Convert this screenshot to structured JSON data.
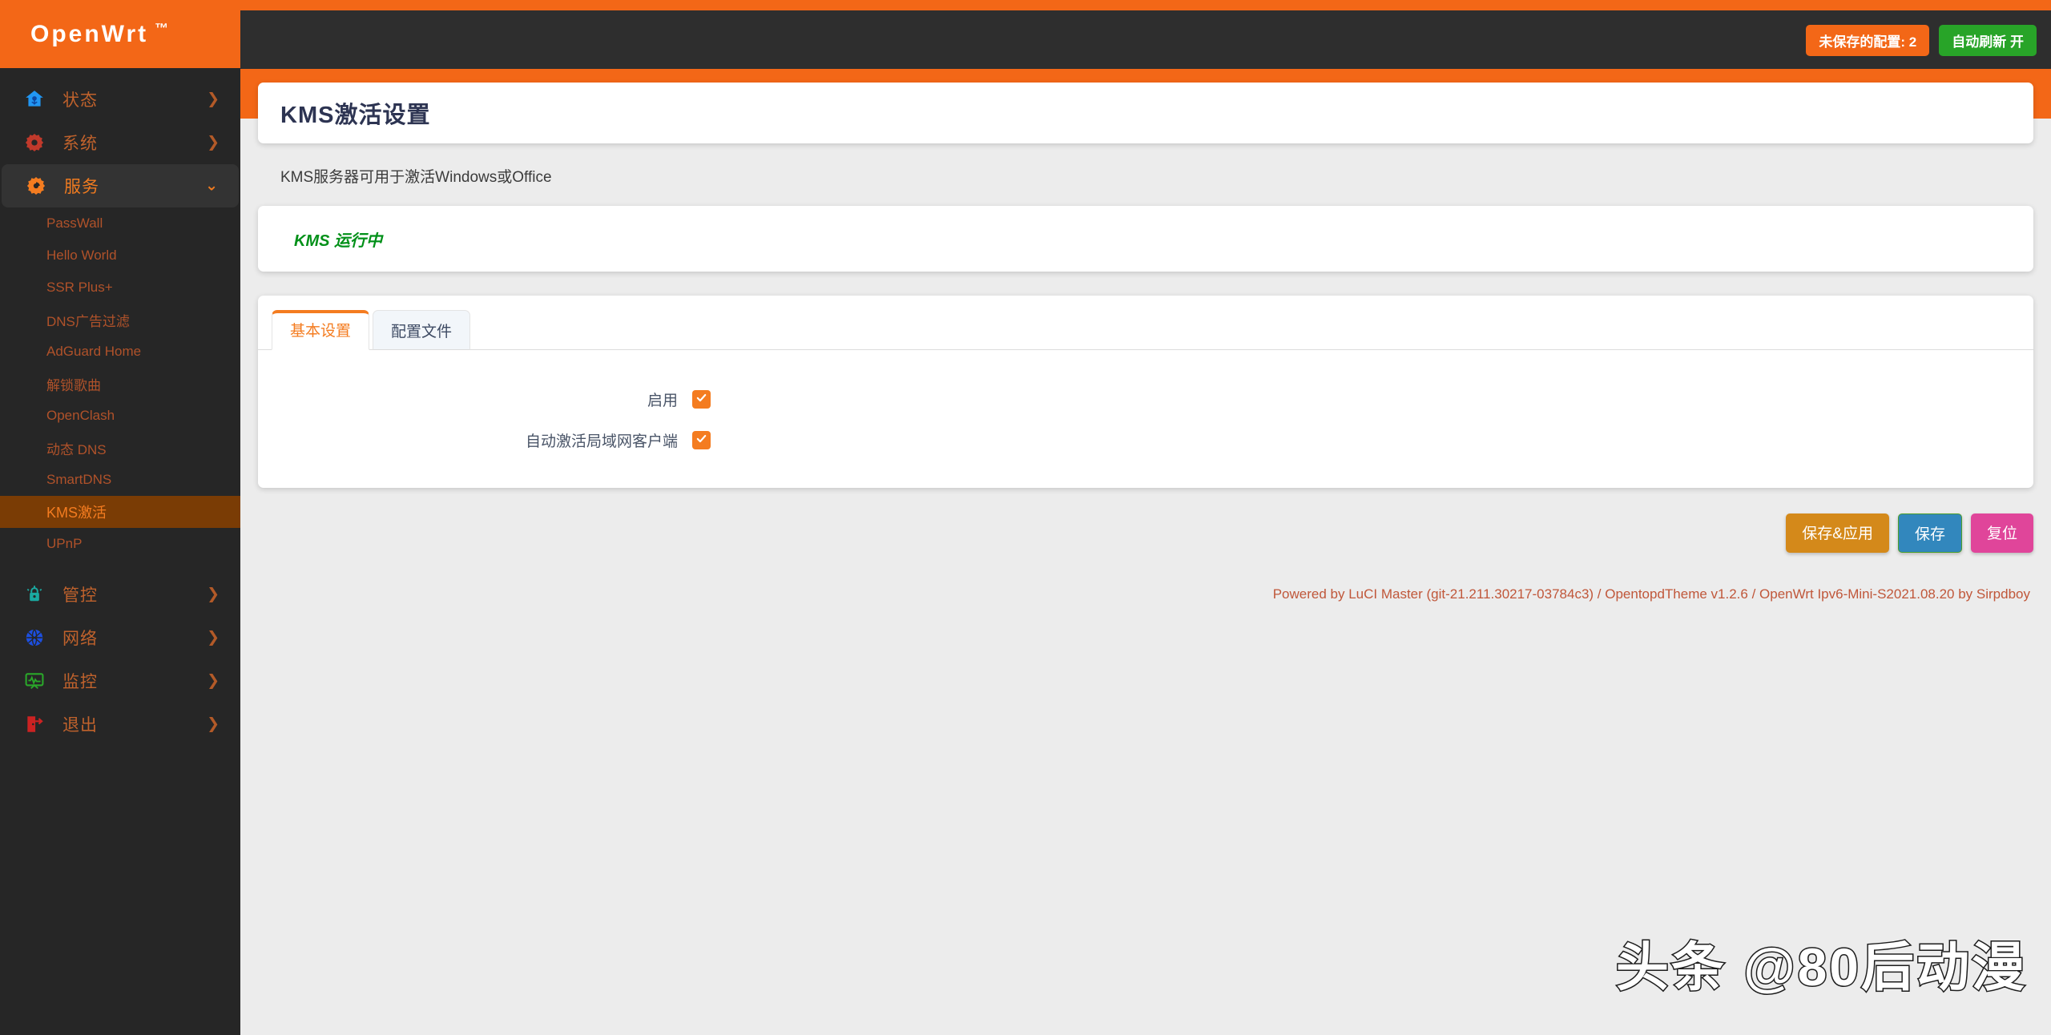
{
  "brand": {
    "name": "OpenWrt",
    "tm": "™"
  },
  "topbar": {
    "unsaved_label": "未保存的配置: 2",
    "autorefresh_label": "自动刷新 开",
    "unsaved_color": "#f36717",
    "autorefresh_color": "#28a428"
  },
  "sidebar": {
    "top_items": [
      {
        "label": "状态",
        "icon": "home-icon",
        "chevron": "❯",
        "expanded": false
      },
      {
        "label": "系统",
        "icon": "gear-icon",
        "chevron": "❯",
        "expanded": false
      },
      {
        "label": "服务",
        "icon": "service-gear-icon",
        "chevron": "⌄",
        "expanded": true
      }
    ],
    "sub_items": [
      {
        "label": "PassWall",
        "active": false
      },
      {
        "label": "Hello World",
        "active": false
      },
      {
        "label": "SSR Plus+",
        "active": false
      },
      {
        "label": "DNS广告过滤",
        "active": false
      },
      {
        "label": "AdGuard Home",
        "active": false
      },
      {
        "label": "解锁歌曲",
        "active": false
      },
      {
        "label": "OpenClash",
        "active": false
      },
      {
        "label": "动态 DNS",
        "active": false
      },
      {
        "label": "SmartDNS",
        "active": false
      },
      {
        "label": "KMS激活",
        "active": true
      },
      {
        "label": "UPnP",
        "active": false
      }
    ],
    "bottom_items": [
      {
        "label": "管控",
        "icon": "lock-alarm-icon",
        "chevron": "❯"
      },
      {
        "label": "网络",
        "icon": "network-icon",
        "chevron": "❯"
      },
      {
        "label": "监控",
        "icon": "monitor-icon",
        "chevron": "❯"
      },
      {
        "label": "退出",
        "icon": "logout-icon",
        "chevron": "❯"
      }
    ]
  },
  "page": {
    "title": "KMS激活设置",
    "description": "KMS服务器可用于激活Windows或Office",
    "status_text": "KMS 运行中",
    "status_color": "#009018"
  },
  "tabs": [
    {
      "label": "基本设置",
      "active": true
    },
    {
      "label": "配置文件",
      "active": false
    }
  ],
  "form": {
    "rows": [
      {
        "label": "启用",
        "checked": true
      },
      {
        "label": "自动激活局域网客户端",
        "checked": true
      }
    ]
  },
  "actions": [
    {
      "label": "保存&应用",
      "kind": "apply"
    },
    {
      "label": "保存",
      "kind": "save"
    },
    {
      "label": "复位",
      "kind": "reset"
    }
  ],
  "footer": {
    "text": "Powered by LuCI Master (git-21.211.30217-03784c3) / OpentopdTheme v1.2.6 / OpenWrt Ipv6-Mini-S2021.08.20 by Sirpdboy"
  },
  "watermark": {
    "text": "头条 @80后动漫"
  }
}
